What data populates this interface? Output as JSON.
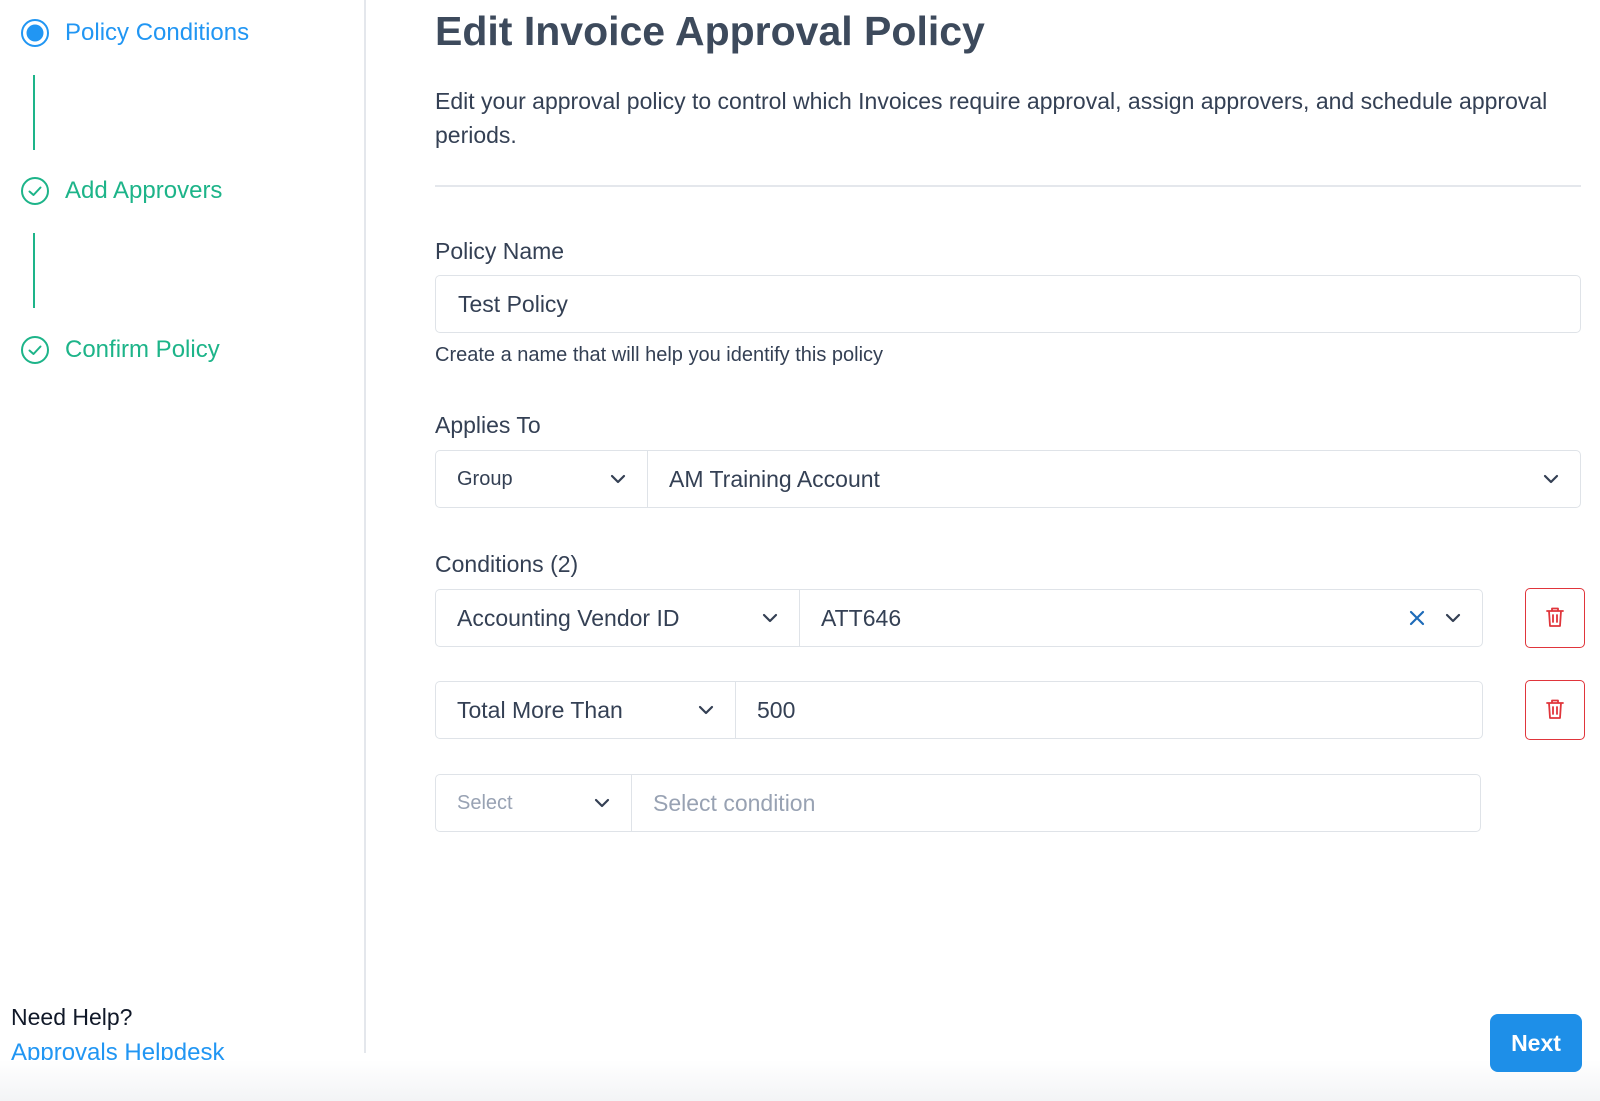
{
  "colors": {
    "accent": "#2196f3",
    "success": "#1db489",
    "danger": "#e0353b",
    "primary_button": "#1e8fe8"
  },
  "steps": [
    {
      "label": "Policy Conditions",
      "state": "current",
      "icon": "radio-current-icon"
    },
    {
      "label": "Add Approvers",
      "state": "done",
      "icon": "check-circle-icon"
    },
    {
      "label": "Confirm Policy",
      "state": "done",
      "icon": "check-circle-icon"
    }
  ],
  "help": {
    "title": "Need Help?",
    "link": "Approvals Helpdesk"
  },
  "page": {
    "title": "Edit Invoice Approval Policy",
    "description": "Edit your approval policy to control which Invoices require approval, assign approvers, and schedule approval periods."
  },
  "policy_name": {
    "label": "Policy Name",
    "value": "Test Policy",
    "hint": "Create a name that will help you identify this policy"
  },
  "applies_to": {
    "label": "Applies To",
    "type": "Group",
    "value": "AM Training Account"
  },
  "conditions": {
    "label": "Conditions (2)",
    "rows": [
      {
        "field": "Accounting Vendor ID",
        "value": "ATT646"
      },
      {
        "field": "Total More Than",
        "value": "500"
      }
    ],
    "new_row": {
      "field_placeholder": "Select",
      "value_placeholder": "Select condition"
    }
  },
  "actions": {
    "next": "Next"
  }
}
